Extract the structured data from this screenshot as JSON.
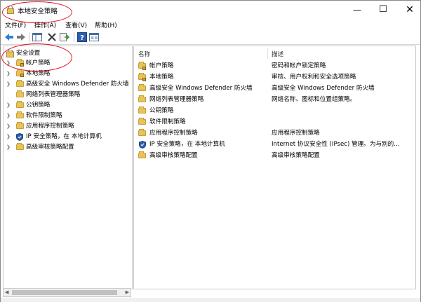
{
  "window": {
    "title": "本地安全策略",
    "minimize_glyph": "—",
    "maximize_glyph": "☐",
    "close_glyph": "✕"
  },
  "menu": [
    "文件(F)",
    "操作(A)",
    "查看(V)",
    "帮助(H)"
  ],
  "toolbar": {
    "buttons": [
      "back-arrow-icon",
      "forward-arrow-icon",
      "show-hide-tree-icon",
      "delete-icon",
      "export-list-icon",
      "help-icon",
      "properties-icon"
    ]
  },
  "tree": {
    "root": "安全设置",
    "items": [
      {
        "label": "帐户策略",
        "expandable": true
      },
      {
        "label": "本地策略",
        "expandable": true
      },
      {
        "label": "高级安全 Windows Defender 防火墙",
        "expandable": true
      },
      {
        "label": "网络列表管理器策略",
        "expandable": false
      },
      {
        "label": "公钥策略",
        "expandable": true
      },
      {
        "label": "软件限制策略",
        "expandable": true
      },
      {
        "label": "应用程序控制策略",
        "expandable": true
      },
      {
        "label": "IP 安全策略，在 本地计算机",
        "expandable": true
      },
      {
        "label": "高级审核策略配置",
        "expandable": true
      }
    ]
  },
  "list": {
    "headers": {
      "name": "名称",
      "description": "描述"
    },
    "rows": [
      {
        "name": "帐户策略",
        "description": "密码和帐户锁定策略",
        "icon": "lock-folder-icon"
      },
      {
        "name": "本地策略",
        "description": "审核、用户权利和安全选项策略",
        "icon": "lock-folder-icon"
      },
      {
        "name": "高级安全 Windows Defender 防火墙",
        "description": "高级安全 Windows Defender 防火墙",
        "icon": "folder-icon"
      },
      {
        "name": "网络列表管理器策略",
        "description": "网络名称、图标和位置组策略。",
        "icon": "folder-icon"
      },
      {
        "name": "公钥策略",
        "description": "",
        "icon": "folder-icon"
      },
      {
        "name": "软件限制策略",
        "description": "",
        "icon": "folder-icon"
      },
      {
        "name": "应用程序控制策略",
        "description": "应用程序控制策略",
        "icon": "folder-icon"
      },
      {
        "name": "IP 安全策略，在 本地计算机",
        "description": "Internet 协议安全性 (IPsec) 管理。为与别的...",
        "icon": "shield-icon"
      },
      {
        "name": "高级审核策略配置",
        "description": "高级审核策略配置",
        "icon": "folder-icon"
      }
    ]
  },
  "colors": {
    "accent": "#1e6ec8",
    "folder": "#e8c25c",
    "annotation_circle": "#e0101a"
  }
}
